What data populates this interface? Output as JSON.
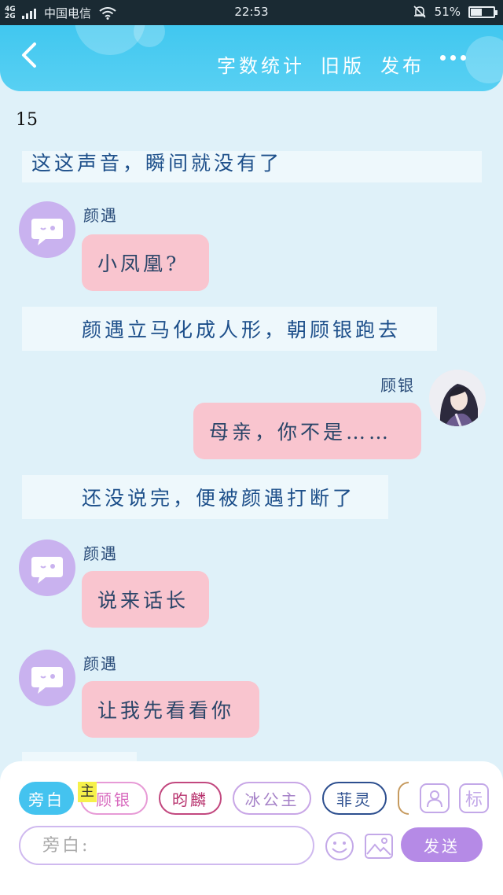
{
  "status_bar": {
    "network_top": "4G",
    "network_bottom": "2G",
    "carrier": "中国电信",
    "time": "22:53",
    "battery_text": "51%",
    "battery_level": 0.51
  },
  "header": {
    "back_icon": "chevron-left-icon",
    "word_count_label": "字数统计",
    "old_version_label": "旧版",
    "publish_label": "发布",
    "more_icon": "more-dots-icon"
  },
  "content": {
    "count": "15",
    "narration_1": "这这声音，瞬间就没有了",
    "speaker_1": "颜遇",
    "message_1": "小凤凰?",
    "narration_2": "颜遇立马化成人形，朝顾银跑去",
    "speaker_2": "顾银",
    "message_2": "母亲，你不是……",
    "narration_3": "还没说完，便被颜遇打断了",
    "speaker_3": "颜遇",
    "message_3": "说来话长",
    "speaker_4": "颜遇",
    "message_4": "让我先看看你"
  },
  "composer": {
    "roles": [
      "旁白",
      "顾银",
      "昀麟",
      "冰公主",
      "菲灵"
    ],
    "main_badge": "主",
    "tag_button": "标",
    "input_placeholder": "旁白:",
    "send_label": "发送"
  },
  "colors": {
    "header": "#38c4ee",
    "background": "#dff1f9",
    "message_bubble": "#f9c5cf",
    "avatar": "#c9b2ef",
    "send_button": "#b58ae6",
    "active_role": "#44c3ef"
  }
}
